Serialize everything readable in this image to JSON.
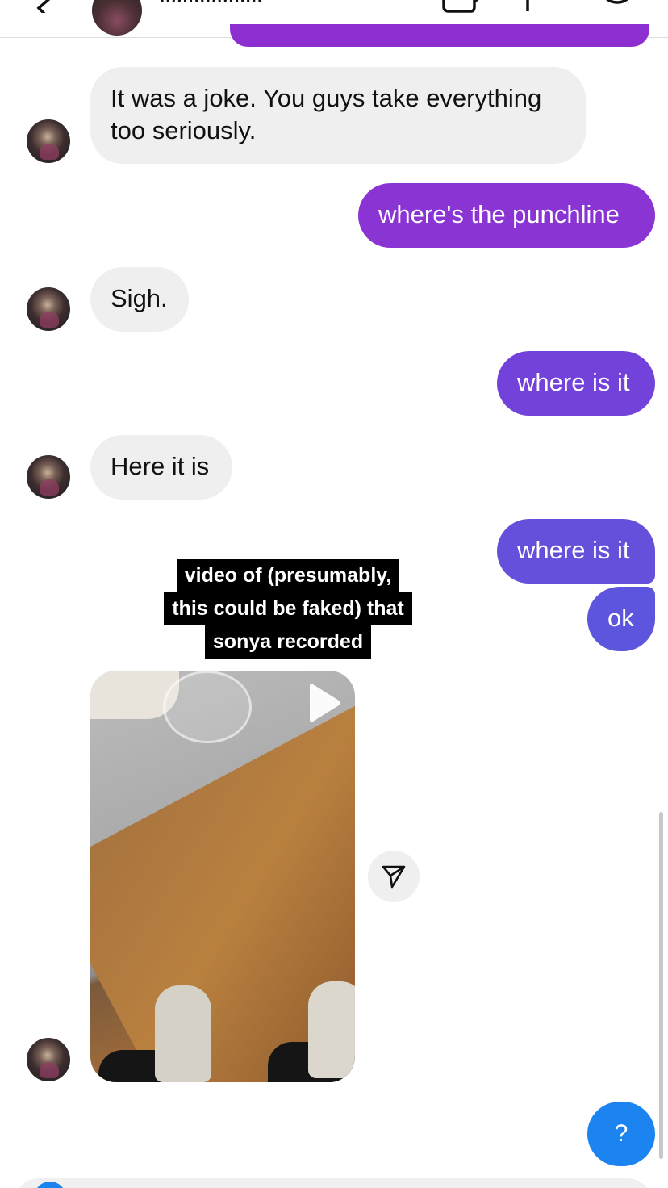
{
  "header": {
    "contact_name": "llllllllllllllllll"
  },
  "messages": [
    {
      "side": "received",
      "text_lines": [
        "It was a joke. You guys take everything",
        "too seriously."
      ]
    },
    {
      "side": "sent",
      "text": "where's the punchline"
    },
    {
      "side": "received",
      "text": "Sigh."
    },
    {
      "side": "sent",
      "text": "where is it"
    },
    {
      "side": "received",
      "text": "Here it is"
    },
    {
      "side": "sent",
      "text": "where is it"
    },
    {
      "side": "sent",
      "text": "ok"
    }
  ],
  "caption_lines": [
    "video of (presumably,",
    "this could be faked) that",
    "sonya recorded"
  ],
  "help_button_label": "?",
  "colors": {
    "sent_purple": "#8d2fd0",
    "sent_purple_2": "#7a3fd8",
    "sent_violet": "#6a4fd8",
    "sent_indigo": "#5c55dd",
    "received_bg": "#efefef",
    "help_blue": "#1b84f0"
  }
}
